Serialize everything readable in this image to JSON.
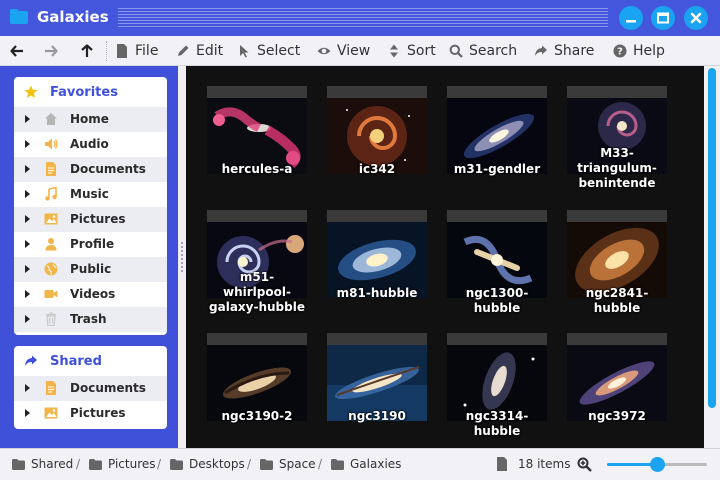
{
  "window": {
    "title": "Galaxies"
  },
  "menu": {
    "back": "back-icon",
    "forward": "forward-icon",
    "up": "up-icon",
    "file": "File",
    "edit": "Edit",
    "select": "Select",
    "view": "View",
    "sort": "Sort",
    "search": "Search",
    "share": "Share",
    "help": "Help"
  },
  "sidebar": {
    "favorites_title": "Favorites",
    "favorites": [
      {
        "label": "Home",
        "icon": "home-icon"
      },
      {
        "label": "Audio",
        "icon": "audio-icon"
      },
      {
        "label": "Documents",
        "icon": "document-icon"
      },
      {
        "label": "Music",
        "icon": "music-icon"
      },
      {
        "label": "Pictures",
        "icon": "picture-icon"
      },
      {
        "label": "Profile",
        "icon": "profile-icon"
      },
      {
        "label": "Public",
        "icon": "globe-icon"
      },
      {
        "label": "Videos",
        "icon": "video-icon"
      },
      {
        "label": "Trash",
        "icon": "trash-icon"
      }
    ],
    "shared_title": "Shared",
    "shared": [
      {
        "label": "Documents",
        "icon": "document-icon"
      },
      {
        "label": "Pictures",
        "icon": "picture-icon"
      }
    ]
  },
  "files": [
    "hercules-a",
    "ic342",
    "m31-gendler",
    "M33-triangulum-\nbenintende",
    "m51-whirlpool-\ngalaxy-hubble",
    "m81-hubble",
    "ngc1300-hubble",
    "ngc2841-hubble",
    "ngc3190-2",
    "ngc3190",
    "ngc3314-hubble",
    "ngc3972"
  ],
  "status": {
    "breadcrumb": [
      "Shared",
      "Pictures",
      "Desktops",
      "Space",
      "Galaxies"
    ],
    "items": "18 items",
    "zoom_level": 0.5
  },
  "colors": {
    "accent": "#3f51d8",
    "highlight": "#1aa3ee"
  }
}
